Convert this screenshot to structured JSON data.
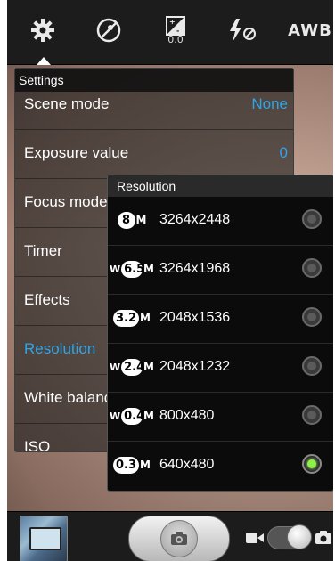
{
  "topbar": {
    "settings_icon": "gear-icon",
    "scene_icon": "scene-mode-icon",
    "ev_icon": "exposure-icon",
    "ev_value": "0.0",
    "flash_icon": "flash-off-icon",
    "awb_label": "AWB"
  },
  "settings": {
    "title": "Settings",
    "rows": [
      {
        "label": "Scene mode",
        "value": "None"
      },
      {
        "label": "Exposure value",
        "value": "0"
      },
      {
        "label": "Focus mode",
        "value": ""
      },
      {
        "label": "Timer",
        "value": ""
      },
      {
        "label": "Effects",
        "value": ""
      },
      {
        "label": "Resolution",
        "value": ""
      },
      {
        "label": "White balance",
        "value": ""
      },
      {
        "label": "ISO",
        "value": ""
      }
    ]
  },
  "resolution": {
    "title": "Resolution",
    "items": [
      {
        "prefix": "",
        "mp": "8",
        "suffix": "M",
        "size": "3264x2448",
        "selected": false
      },
      {
        "prefix": "W",
        "mp": "6.5",
        "suffix": "M",
        "size": "3264x1968",
        "selected": false
      },
      {
        "prefix": "",
        "mp": "3.2",
        "suffix": "M",
        "size": "2048x1536",
        "selected": false
      },
      {
        "prefix": "W",
        "mp": "2.4",
        "suffix": "M",
        "size": "2048x1232",
        "selected": false
      },
      {
        "prefix": "W",
        "mp": "0.4",
        "suffix": "M",
        "size": "800x480",
        "selected": false
      },
      {
        "prefix": "",
        "mp": "0.3",
        "suffix": "M",
        "size": "640x480",
        "selected": true
      }
    ]
  },
  "bottombar": {
    "thumbnail": "gallery-thumbnail",
    "shutter_icon": "camera-icon",
    "video_icon": "video-camera-icon",
    "photo_icon": "camera-icon"
  },
  "colors": {
    "accent": "#2fa5e8",
    "selected_radio": "#8ef04a"
  }
}
